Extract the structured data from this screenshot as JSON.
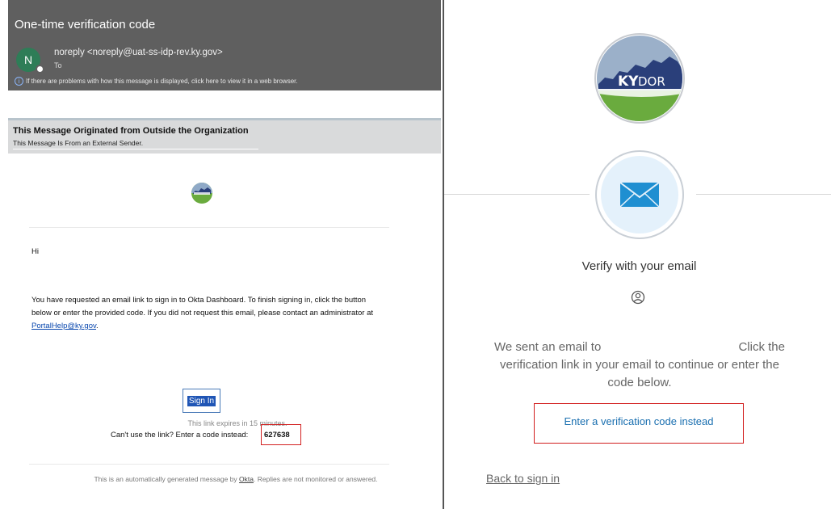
{
  "email": {
    "subject": "One-time verification code",
    "sender_initial": "N",
    "sender": "noreply <noreply@uat-ss-idp-rev.ky.gov>",
    "to_label": "To",
    "display_notice": "If there are problems with how this message is displayed, click here to view it in a web browser.",
    "external_banner": {
      "title": "This Message Originated from Outside the Organization",
      "subtitle": "This Message Is From an External Sender."
    },
    "greeting": "Hi",
    "body_text": "You have requested an email link to sign in to Okta Dashboard. To finish signing in, click the button below or enter the provided code. If you did not request this email, please contact an administrator at",
    "admin_email": "PortalHelp@ky.gov",
    "body_end": ".",
    "sign_in_label": "Sign In",
    "expires_text": "This link expires in 15 minutes.",
    "code_prompt": "Can't use the link? Enter a code instead:",
    "code": "627638",
    "footer_text": "This is an automatically generated message by",
    "footer_link": "Okta",
    "footer_end": ". Replies are not monitored or answered."
  },
  "verify": {
    "logo_text_ky": "KY",
    "logo_text_dor": "DOR",
    "title": "Verify with your email",
    "sent_part1": "We sent an email to",
    "sent_part2": "Click the",
    "sent_rest": "verification link in your email to continue or enter the code below.",
    "alt_link": "Enter a verification code instead",
    "back_link": "Back to sign in"
  },
  "icons": {
    "user": "user-circle-icon",
    "mail": "envelope-icon",
    "info": "info-icon"
  },
  "colors": {
    "header_bg": "#5f5f5f",
    "banner_bg": "#d9dadb",
    "link_blue": "#1a6fb0",
    "highlight_red": "#d21f1f",
    "logo_blue": "#2a3f7a",
    "logo_green": "#6aab3e"
  }
}
